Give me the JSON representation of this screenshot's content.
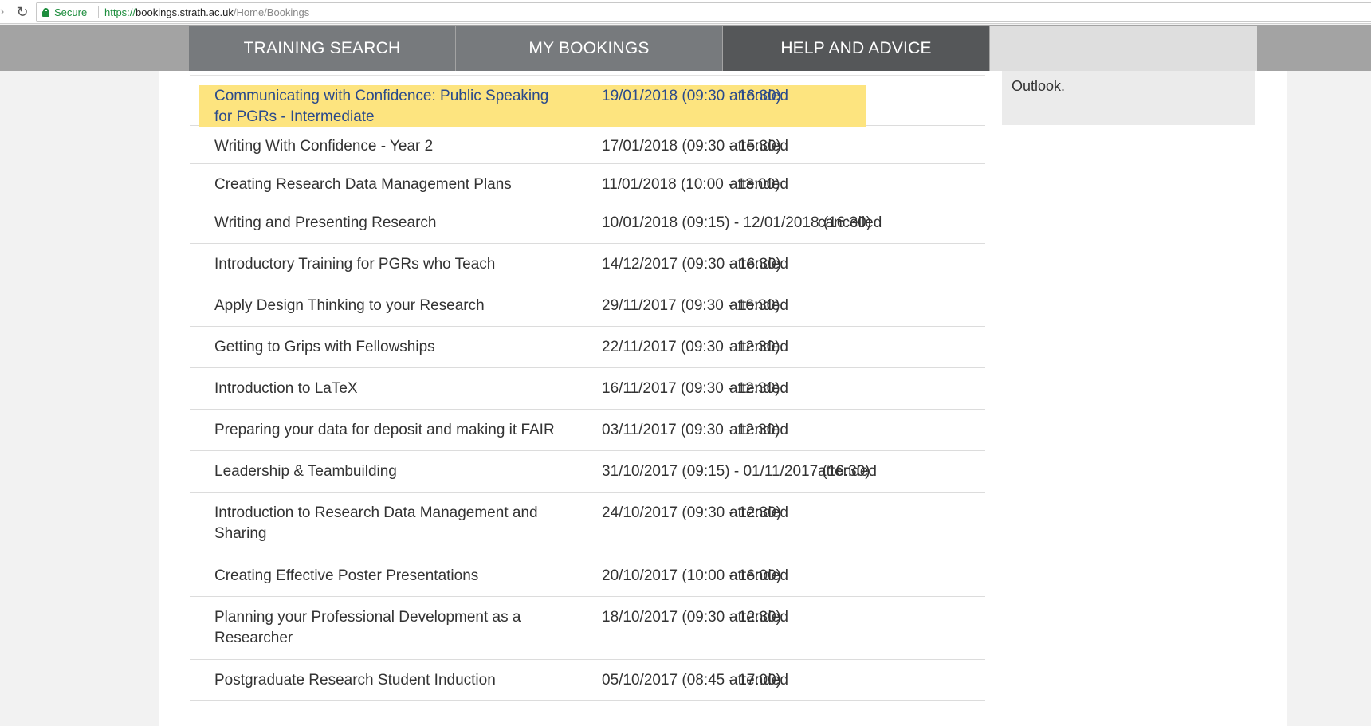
{
  "browser": {
    "secure_label": "Secure",
    "url_protocol": "https://",
    "url_host": "bookings.strath.ac.uk",
    "url_path": "/Home/Bookings"
  },
  "nav": {
    "tabs": [
      {
        "label": "TRAINING SEARCH"
      },
      {
        "label": "MY BOOKINGS"
      },
      {
        "label": "HELP AND ADVICE"
      }
    ]
  },
  "side_panel": {
    "text": "Outlook."
  },
  "bookings": [
    {
      "title": "Communicating with Confidence: Public Speaking for PGRs - Intermediate",
      "date": "19/01/2018 (09:30 - 16:30)",
      "status": "attended"
    },
    {
      "title": "Writing With Confidence - Year 2",
      "date": "17/01/2018 (09:30 - 15:30)",
      "status": "attended"
    },
    {
      "title": "Creating Research Data Management Plans",
      "date": "11/01/2018 (10:00 - 13:00)",
      "status": "attended"
    },
    {
      "title": "Writing and Presenting Research",
      "date": "10/01/2018 (09:15) - 12/01/2018 (16:30)",
      "status": "cancelled"
    },
    {
      "title": "Introductory Training for PGRs who Teach",
      "date": "14/12/2017 (09:30 - 16:30)",
      "status": "attended"
    },
    {
      "title": "Apply Design Thinking to your Research",
      "date": "29/11/2017 (09:30 - 16:30)",
      "status": "attended"
    },
    {
      "title": "Getting to Grips with Fellowships",
      "date": "22/11/2017 (09:30 - 12:30)",
      "status": "attended"
    },
    {
      "title": "Introduction to LaTeX",
      "date": "16/11/2017 (09:30 - 12:30)",
      "status": "attended"
    },
    {
      "title": "Preparing your data for deposit and making it FAIR",
      "date": "03/11/2017 (09:30 - 12:30)",
      "status": "attended"
    },
    {
      "title": "Leadership & Teambuilding",
      "date": "31/10/2017 (09:15) - 01/11/2017 (16:30)",
      "status": "attended"
    },
    {
      "title": "Introduction to Research Data Management and Sharing",
      "date": "24/10/2017 (09:30 - 12:30)",
      "status": "attended"
    },
    {
      "title": "Creating Effective Poster Presentations",
      "date": "20/10/2017 (10:00 - 16:00)",
      "status": "attended"
    },
    {
      "title": "Planning your Professional Development as a Researcher",
      "date": "18/10/2017 (09:30 - 12:30)",
      "status": "attended"
    },
    {
      "title": "Postgraduate Research Student Induction",
      "date": "05/10/2017 (08:45 - 17:00)",
      "status": "attended"
    }
  ]
}
